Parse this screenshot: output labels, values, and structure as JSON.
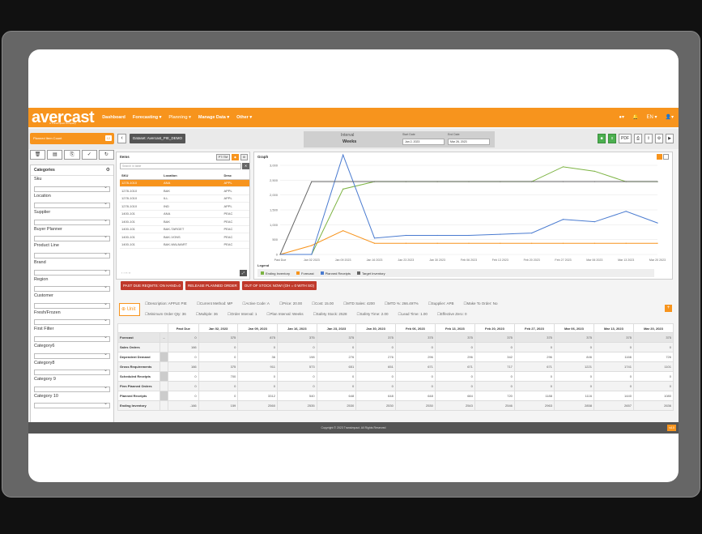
{
  "header": {
    "logo": "avercast",
    "logo_sub": "A TransImpact Company",
    "nav": [
      "Dashboard",
      "Forecasting ▾",
      "Planning ▾",
      "Manage Data ▾",
      "Other ▾"
    ],
    "user": "EN ▾",
    "active_nav": "Planning ▾"
  },
  "subbar": {
    "planned_label": "Planned Item Count",
    "planned_count": "12",
    "back": "‹",
    "dataset": "Dataset: Avercast_PIE_DEMO",
    "interval_label": "Interval",
    "interval_value": "Weeks",
    "start_label": "Start Date",
    "start_value": "Jan 2, 2023",
    "end_label": "End Date",
    "end_value": "Mar 26, 2023"
  },
  "categories": {
    "title": "Categories",
    "items": [
      "Sku",
      "Location",
      "Supplier",
      "Buyer Planner",
      "Product Line",
      "Brand",
      "Region",
      "Customer",
      "Fresh/Frozen",
      "First Filter",
      "Category6",
      "Category8",
      "Category 9",
      "Category 10"
    ]
  },
  "items": {
    "title": "Items",
    "search_placeholder": "Search in table",
    "columns": [
      "SKU",
      "Location",
      "Desc"
    ],
    "rows": [
      [
        "1278-1010",
        "ANA",
        "APPL"
      ],
      [
        "1278-1010",
        "BAK",
        "APPL"
      ],
      [
        "1278-1010",
        "ILL",
        "APPL"
      ],
      [
        "1278-1010",
        "IND",
        "APPL"
      ],
      [
        "1400-101",
        "ANA",
        "PEAC"
      ],
      [
        "1400-101",
        "BAK",
        "PEAC"
      ],
      [
        "1400-101",
        "BAK-TARGET",
        "PEAC"
      ],
      [
        "1400-101",
        "BAK-VONS",
        "PEAC"
      ],
      [
        "1400-101",
        "BAK-WALMART",
        "PEAC"
      ]
    ]
  },
  "chart_data": {
    "type": "line",
    "title": "Graph",
    "categories": [
      "Past Due",
      "Jan 02 2023",
      "Jan 09 2023",
      "Jan 16 2023",
      "Jan 23 2023",
      "Jan 30 2023",
      "Feb 06 2023",
      "Feb 13 2023",
      "Feb 20 2023",
      "Feb 27 2023",
      "Mar 06 2023",
      "Mar 13 2023",
      "Mar 20 2023"
    ],
    "ylim": [
      0,
      3000
    ],
    "yticks": [
      "0",
      "500",
      "1,000",
      "1,500",
      "2,000",
      "2,500",
      "3,000"
    ],
    "legend_title": "Legend",
    "series": [
      {
        "name": "Ending Inventory",
        "color": "#7cb342",
        "values": [
          0,
          0,
          2200,
          2450,
          2450,
          2450,
          2450,
          2450,
          2450,
          2950,
          2800,
          2450,
          2450
        ]
      },
      {
        "name": "Forecast",
        "color": "#f7941d",
        "values": [
          0,
          300,
          800,
          375,
          375,
          375,
          375,
          375,
          375,
          375,
          375,
          375,
          375
        ]
      },
      {
        "name": "Planned Receipts",
        "color": "#4a7bd0",
        "values": [
          0,
          0,
          3350,
          550,
          640,
          640,
          640,
          680,
          720,
          1180,
          1100,
          1450,
          1060
        ]
      },
      {
        "name": "Target Inventory",
        "color": "#666666",
        "values": [
          0,
          2450,
          2450,
          2450,
          2450,
          2450,
          2450,
          2450,
          2450,
          2450,
          2450,
          2450,
          2450
        ]
      }
    ]
  },
  "actions": [
    "PAST DUE REQMTS: ON HAND=0",
    "RELEASE PLANNED ORDER",
    "OUT OF STOCK NOW! (OH = 0 WITH SO)"
  ],
  "unit": {
    "label": "Unit",
    "row1": [
      "Description: APPLE PIE",
      "Current Method: MP",
      "Active Code: A",
      "Price: 20.00",
      "Cost: 15.00",
      "MTD Sales: 4200",
      "MTD %: 266.497%",
      "Supplier: APB",
      "Make To Order: No"
    ],
    "row2": [
      "Minimum Order Qty: 36",
      "Multiple: 36",
      "Order Interval: 1",
      "Plan Interval: Weeks",
      "Safety Stock: 2528",
      "Safety Time: 2.00",
      "Lead Time: 1.00",
      "Effective Zero: 0"
    ]
  },
  "plan": {
    "headers": [
      "Past Due",
      "Jan 02, 2023",
      "Jan 09, 2023",
      "Jan 16, 2023",
      "Jan 23, 2023",
      "Jan 30, 2023",
      "Feb 06, 2023",
      "Feb 13, 2023",
      "Feb 20, 2023",
      "Feb 27, 2023",
      "Mar 06, 2023",
      "Mar 13, 2023",
      "Mar 20, 2023"
    ],
    "rows": [
      {
        "label": "Forecast",
        "cells": [
          "0",
          "375",
          "875",
          "375",
          "375",
          "375",
          "375",
          "375",
          "375",
          "375",
          "375",
          "375",
          "375"
        ]
      },
      {
        "label": "Sales Orders",
        "cells": [
          "166",
          "0",
          "0",
          "0",
          "0",
          "0",
          "0",
          "0",
          "0",
          "0",
          "0",
          "0",
          "0"
        ]
      },
      {
        "label": "Dependent Demand",
        "cells": [
          "0",
          "0",
          "36",
          "198",
          "276",
          "276",
          "296",
          "296",
          "342",
          "296",
          "846",
          "1166",
          "726"
        ]
      },
      {
        "label": "Gross Requirements",
        "cells": [
          "166",
          "375",
          "911",
          "573",
          "651",
          "651",
          "671",
          "671",
          "717",
          "671",
          "1221",
          "1741",
          "1101"
        ]
      },
      {
        "label": "Scheduled Receipts",
        "cells": [
          "0",
          "700",
          "0",
          "0",
          "0",
          "0",
          "0",
          "0",
          "0",
          "0",
          "0",
          "0",
          "0"
        ]
      },
      {
        "label": "Firm Planned Orders",
        "cells": [
          "0",
          "0",
          "0",
          "0",
          "0",
          "0",
          "0",
          "0",
          "0",
          "0",
          "0",
          "0",
          "0"
        ]
      },
      {
        "label": "Planned Receipts",
        "cells": [
          "0",
          "0",
          "3312",
          "540",
          "648",
          "648",
          "648",
          "684",
          "720",
          "1188",
          "1116",
          "1440",
          "1080"
        ]
      },
      {
        "label": "Ending Inventory",
        "cells": [
          "-166",
          "159",
          "2560",
          "2535",
          "2530",
          "2530",
          "2530",
          "2543",
          "2546",
          "2963",
          "2858",
          "2657",
          "2636"
        ]
      }
    ]
  },
  "footer": {
    "copyright": "Copyright © 2023 TransImpact. All Rights Reserved",
    "badge": "v4.0"
  }
}
